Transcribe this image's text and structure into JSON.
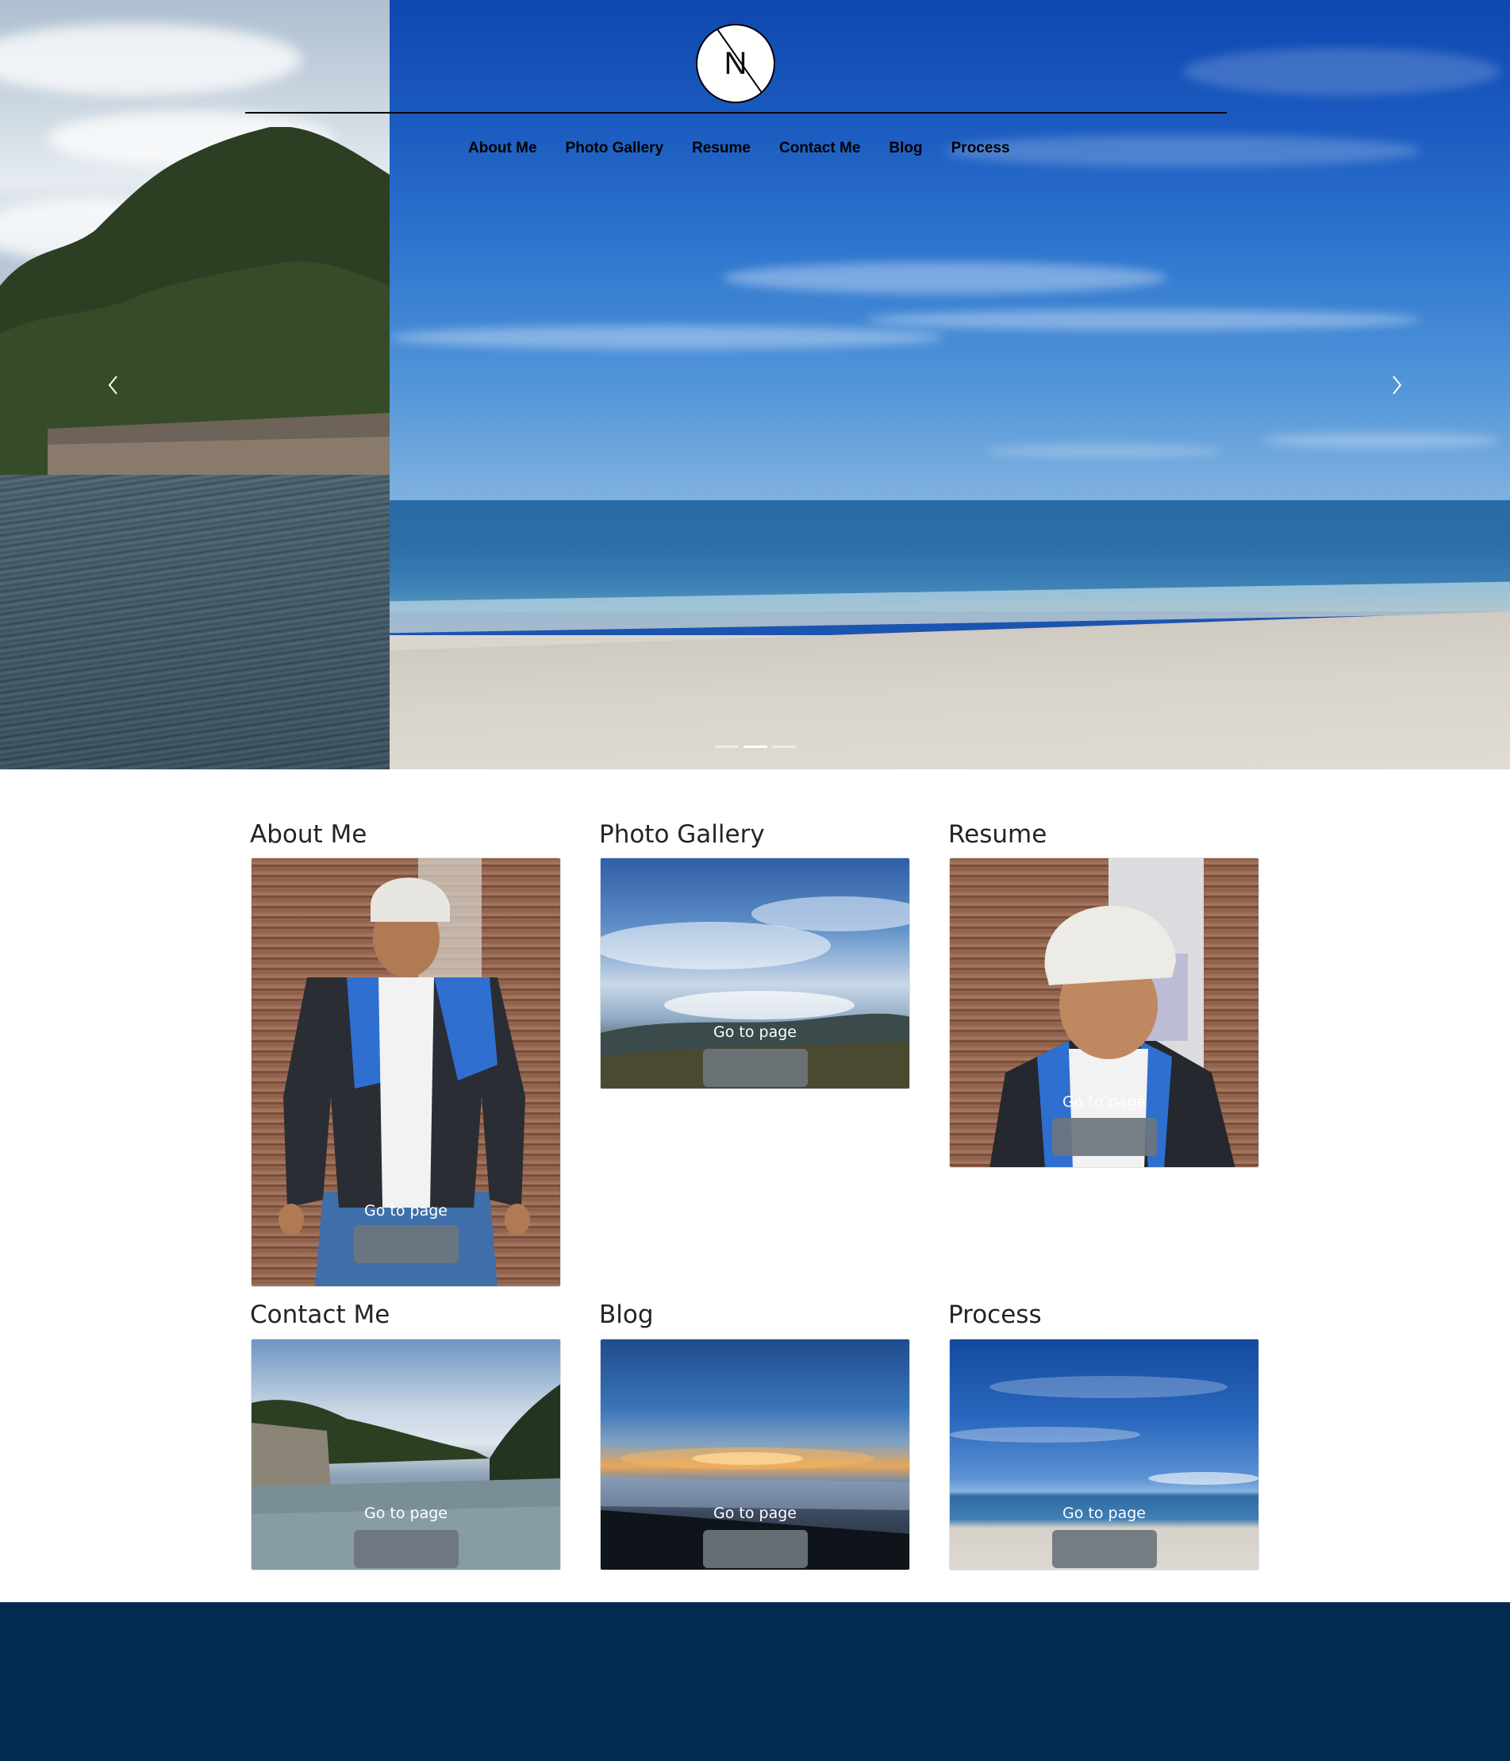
{
  "logo": {
    "letter": "N"
  },
  "nav": {
    "items": [
      "About Me",
      "Photo Gallery",
      "Resume",
      "Contact Me",
      "Blog",
      "Process"
    ]
  },
  "carousel": {
    "prev_icon": "chevron-left-icon",
    "next_icon": "chevron-right-icon",
    "slide_count": 3,
    "active_slide": 2
  },
  "cards": [
    {
      "title": "About Me",
      "button_caption": "Go to page"
    },
    {
      "title": "Photo Gallery",
      "button_caption": "Go to page"
    },
    {
      "title": "Resume",
      "button_caption": "Go to page"
    },
    {
      "title": "Contact Me",
      "button_caption": "Go to page"
    },
    {
      "title": "Blog",
      "button_caption": "Go to page"
    },
    {
      "title": "Process",
      "button_caption": "Go to page"
    }
  ],
  "colors": {
    "footer": "#022b4f",
    "button": "#6c757d",
    "title_text": "#212529"
  }
}
